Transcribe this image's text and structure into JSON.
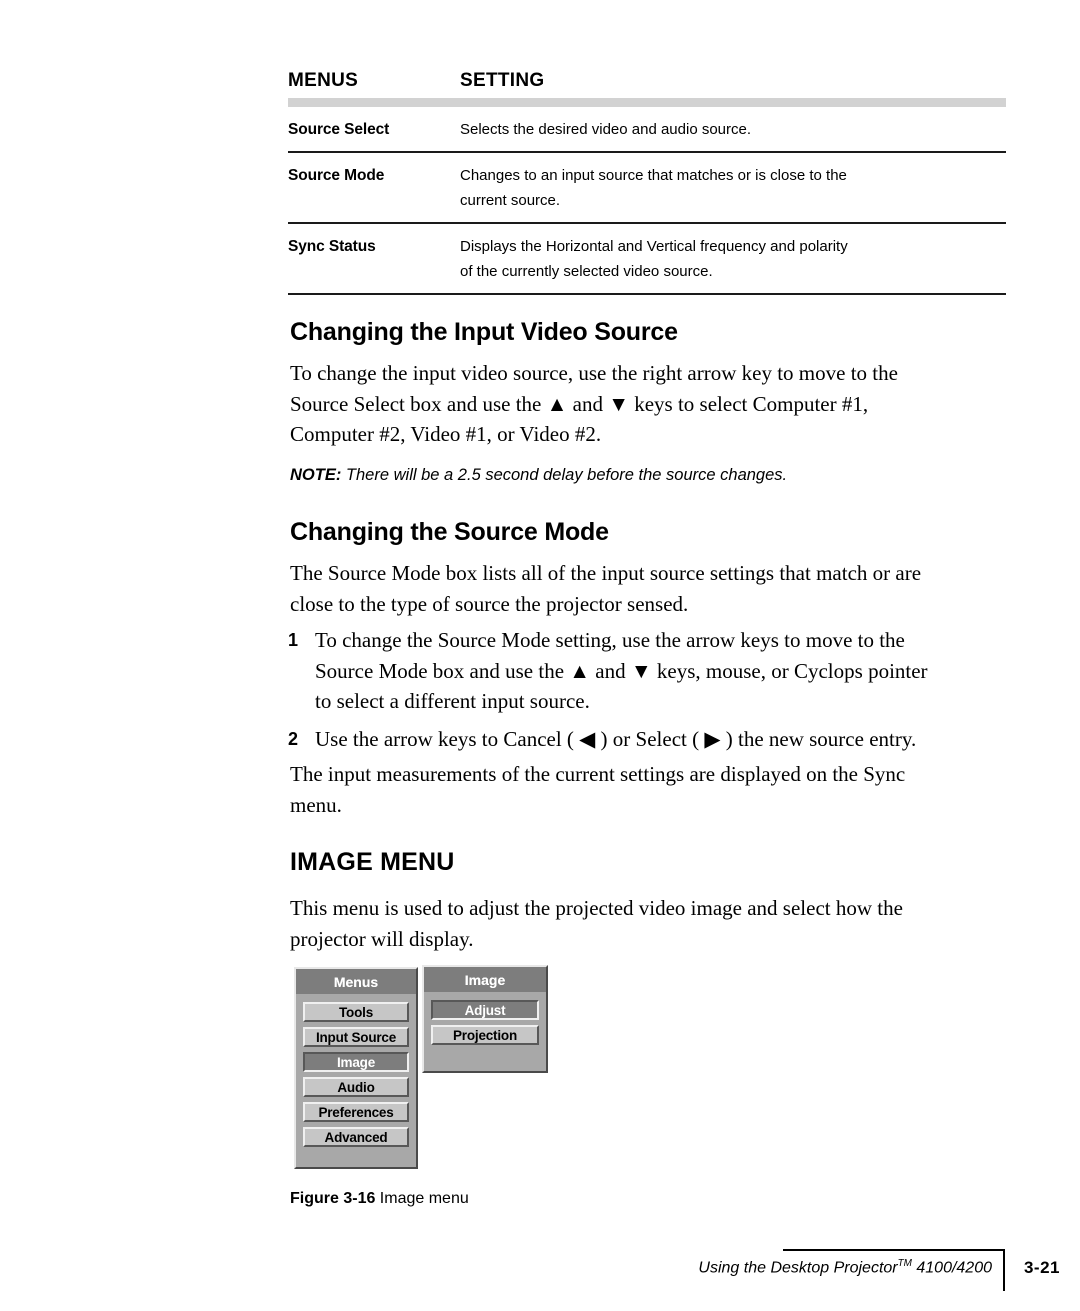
{
  "table": {
    "headers": {
      "menus": "MENUS",
      "setting": "SETTING"
    },
    "rows": [
      {
        "menu": "Source Select",
        "setting_lines": [
          "Selects the desired video and audio source."
        ]
      },
      {
        "menu": "Source Mode",
        "setting_lines": [
          "Changes to an input source that matches or is close to the",
          "current source."
        ]
      },
      {
        "menu": "Sync Status",
        "setting_lines": [
          "Displays the Horizontal and Vertical frequency and polarity",
          "of the currently selected video source."
        ]
      }
    ]
  },
  "sections": {
    "input_video_source": {
      "heading": "Changing the Input Video Source",
      "paragraph_lines": [
        "To change the input video source, use the right arrow key to move to the",
        "Source Select box and use the ▲ and ▼ keys to select Computer #1,",
        "Computer #2, Video #1, or Video #2."
      ],
      "note_label": "NOTE:",
      "note_text": " There will be a 2.5 second delay before the source changes."
    },
    "source_mode": {
      "heading": "Changing the Source Mode",
      "paragraph_lines": [
        "The Source Mode box lists all of the input source settings that match or are",
        "close to the type of source the projector sensed."
      ],
      "steps": [
        {
          "number": "1",
          "lines": [
            "To change the Source Mode setting, use the arrow keys to move to the",
            "Source Mode box and use the ▲ and ▼ keys, mouse, or Cyclops pointer",
            "to select a different input source."
          ]
        },
        {
          "number": "2",
          "lines": [
            "Use the arrow keys to Cancel ( ◀ ) or Select ( ▶ ) the new source entry."
          ]
        }
      ],
      "closing_lines": [
        "The input measurements of the current settings are displayed on the Sync",
        "menu."
      ]
    },
    "image_menu": {
      "heading": "IMAGE MENU",
      "paragraph_lines": [
        "This menu is used to adjust the projected video image and select how the",
        "projector will display."
      ]
    }
  },
  "figure": {
    "menus_panel": {
      "title": "Menus",
      "items": [
        {
          "label": "Tools",
          "selected": false
        },
        {
          "label": "Input Source",
          "selected": false
        },
        {
          "label": "Image",
          "selected": true
        },
        {
          "label": "Audio",
          "selected": false
        },
        {
          "label": "Preferences",
          "selected": false
        },
        {
          "label": "Advanced",
          "selected": false
        }
      ]
    },
    "image_panel": {
      "title": "Image",
      "items": [
        {
          "label": "Adjust",
          "selected": true
        },
        {
          "label": "Projection",
          "selected": false
        }
      ]
    },
    "caption_label": "Figure 3-16",
    "caption_text": " Image menu"
  },
  "footer": {
    "text_before_tm": "Using the Desktop Projector",
    "tm": "TM",
    "text_after_tm": " 4100/4200",
    "page_number": "3-21"
  },
  "colors": {
    "header_bar_gray": "#d2d2d2",
    "panel_bg": "#a8a8a8",
    "panel_title_bg": "#7d7d7d",
    "menu_item_bg": "#c6c6c6",
    "menu_item_selected_bg": "#7d7d7d",
    "rule_black": "#1a1a1a"
  }
}
